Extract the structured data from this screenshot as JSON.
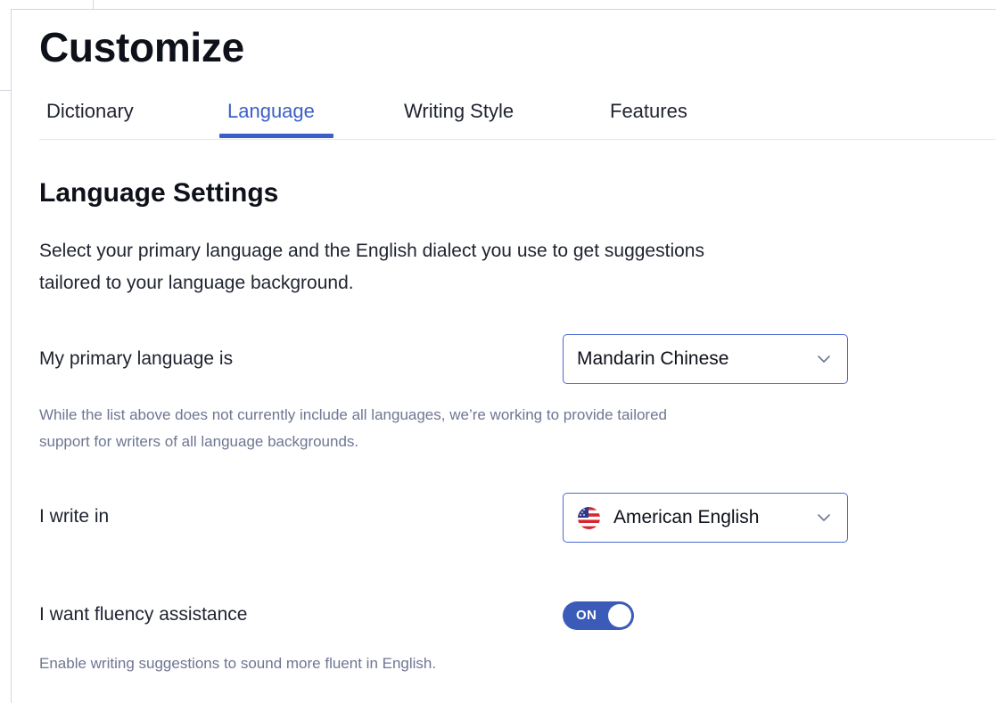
{
  "page": {
    "title": "Customize"
  },
  "tabs": [
    {
      "label": "Dictionary",
      "active": false
    },
    {
      "label": "Language",
      "active": true
    },
    {
      "label": "Writing Style",
      "active": false
    },
    {
      "label": "Features",
      "active": false
    }
  ],
  "language_settings": {
    "title": "Language Settings",
    "intro_line1": "Select your primary language and the English dialect you use to get suggestions",
    "intro_line2": "tailored to your language background.",
    "primary_language": {
      "label": "My primary language is",
      "value": "Mandarin Chinese",
      "hint_line1": "While the list above does not currently include all languages, we’re working to provide tailored",
      "hint_line2": "support for writers of all language backgrounds."
    },
    "dialect": {
      "label": "I write in",
      "value": "American English",
      "flag_icon": "us-flag-icon"
    },
    "fluency": {
      "label": "I want fluency assistance",
      "toggle_state": "ON",
      "enabled": true,
      "hint": "Enable writing suggestions to sound more fluent in English."
    }
  },
  "colors": {
    "accent": "#3b5fc9",
    "toggle_on": "#3b5bb8",
    "select_border": "#4a6ad3",
    "hint_text": "#6e7692"
  }
}
